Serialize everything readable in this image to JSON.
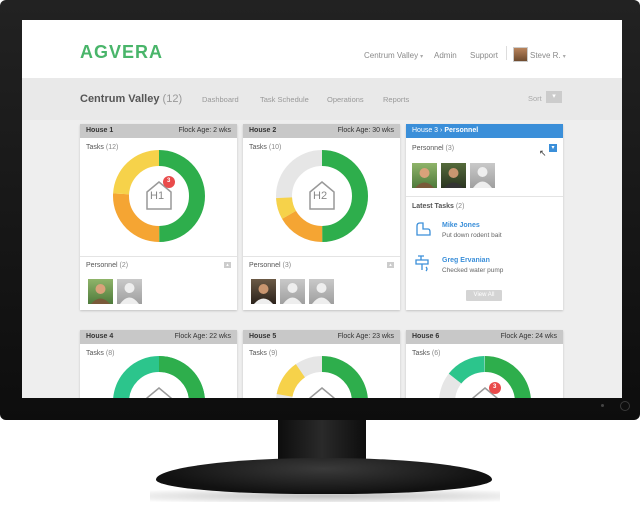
{
  "brand": "AGVERA",
  "topnav": {
    "farm_selector": "Centrum Valley",
    "admin": "Admin",
    "support": "Support",
    "user": "Steve R."
  },
  "subheader": {
    "farm_name": "Centrum Valley",
    "house_count": "(12)",
    "tabs": [
      "Dashboard",
      "Task Schedule",
      "Operations",
      "Reports"
    ],
    "sort_label": "Sort"
  },
  "colors": {
    "brand_green": "#49b56a",
    "accent_blue": "#3b8fd9",
    "dark_green": "#2eae4c",
    "teal": "#2cc58c",
    "orange": "#f5a533",
    "yellow": "#f6d24a",
    "badge_red": "#e94b4b"
  },
  "cards": [
    {
      "name": "House 1",
      "flock_age": "Flock Age: 2 wks",
      "tasks_label": "Tasks",
      "tasks_count": "(12)",
      "house_code": "H1",
      "badge": "3",
      "personnel_label": "Personnel",
      "personnel_count": "(2)"
    },
    {
      "name": "House 2",
      "flock_age": "Flock Age: 30 wks",
      "tasks_label": "Tasks",
      "tasks_count": "(10)",
      "house_code": "H2",
      "personnel_label": "Personnel",
      "personnel_count": "(3)"
    },
    {
      "name": "House 4",
      "flock_age": "Flock Age: 22 wks",
      "tasks_label": "Tasks",
      "tasks_count": "(8)"
    },
    {
      "name": "House 5",
      "flock_age": "Flock Age: 23 wks",
      "tasks_label": "Tasks",
      "tasks_count": "(9)"
    },
    {
      "name": "House 6",
      "flock_age": "Flock Age: 24 wks",
      "tasks_label": "Tasks",
      "tasks_count": "(6)",
      "badge": "3"
    }
  ],
  "house3": {
    "crumb": "House 3",
    "section": "Personnel",
    "personnel_label": "Personnel",
    "personnel_count": "(3)",
    "latest_label": "Latest Tasks",
    "latest_count": "(2)",
    "tasks": [
      {
        "name": "Mike Jones",
        "desc": "Put down rodent bait",
        "icon": "rodent-icon"
      },
      {
        "name": "Greg Ervanian",
        "desc": "Checked water pump",
        "icon": "water-pump-icon"
      }
    ],
    "view_all": "View All"
  }
}
